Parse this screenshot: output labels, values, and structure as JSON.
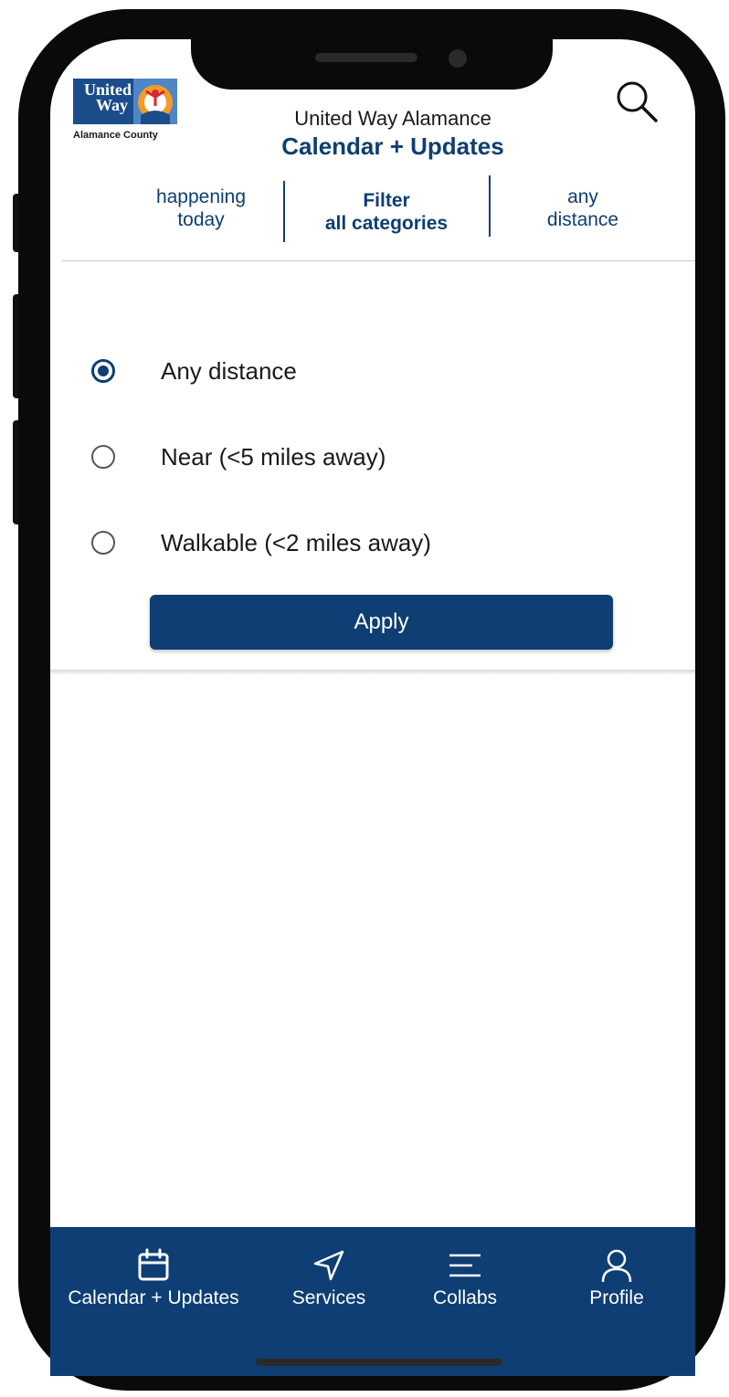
{
  "logo": {
    "line1": "United",
    "line2": "Way",
    "subtitle": "Alamance County"
  },
  "header": {
    "org": "United Way Alamance",
    "title": "Calendar + Updates"
  },
  "filters": {
    "today": {
      "line1": "happening",
      "line2": "today"
    },
    "category": {
      "line1": "Filter",
      "line2": "all categories"
    },
    "distance": {
      "line1": "any",
      "line2": "distance"
    }
  },
  "distance_options": [
    {
      "label": "Any distance",
      "selected": true
    },
    {
      "label": "Near (<5 miles away)",
      "selected": false
    },
    {
      "label": "Walkable (<2 miles away)",
      "selected": false
    }
  ],
  "apply_label": "Apply",
  "bottom_nav": [
    {
      "label": "Calendar + Updates",
      "icon": "calendar-icon"
    },
    {
      "label": "Services",
      "icon": "navigation-arrow-icon"
    },
    {
      "label": "Collabs",
      "icon": "menu-lines-icon"
    },
    {
      "label": "Profile",
      "icon": "person-icon"
    }
  ],
  "colors": {
    "brand_navy": "#0e3e73",
    "logo_blue": "#1b4d8b",
    "logo_light": "#4f86c6",
    "logo_orange": "#f39b2a"
  }
}
